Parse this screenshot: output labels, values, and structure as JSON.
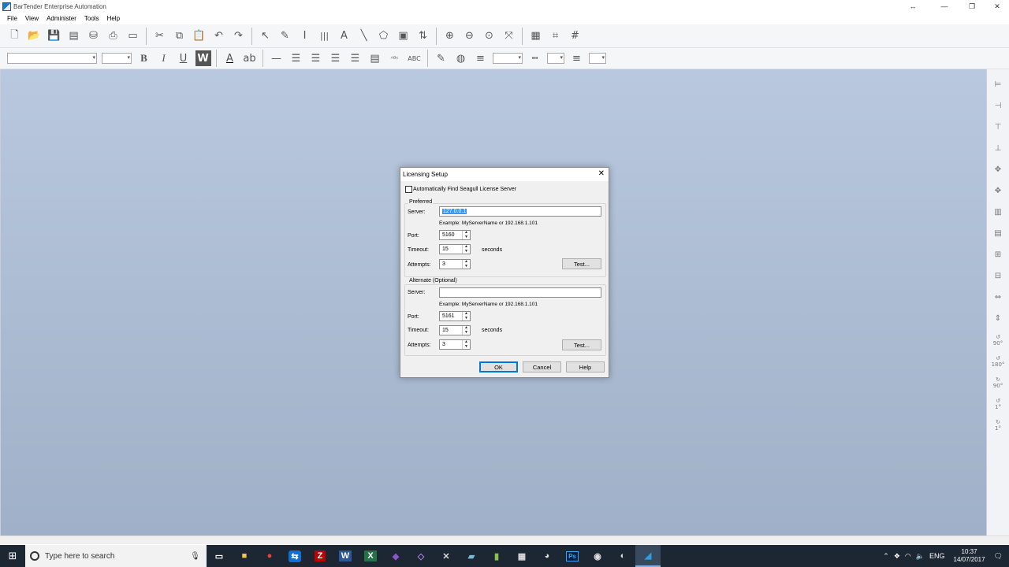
{
  "window": {
    "title": "BarTender Enterprise Automation",
    "restore_glyph": "↔"
  },
  "menu": [
    "File",
    "View",
    "Administer",
    "Tools",
    "Help"
  ],
  "toolbar1_icons": [
    "new-icon",
    "open-icon",
    "save-icon",
    "print-preview-icon",
    "database-icon",
    "print-icon",
    "page-setup-icon",
    "cut-icon",
    "copy-icon",
    "paste-icon",
    "undo-icon",
    "redo-icon",
    "select-icon",
    "brush-icon",
    "text-cursor-icon",
    "barcode-icon",
    "text-icon",
    "line-icon",
    "shape-icon",
    "picture-icon",
    "align-icon",
    "zoom-in-icon",
    "zoom-out-icon",
    "zoom-fit-icon",
    "zoom-page-icon",
    "ruler-icon",
    "snap-icon",
    "grid-icon"
  ],
  "toolbar2": {
    "bold": "B",
    "italic": "I",
    "underline": "U",
    "word_wrap": "W",
    "font_color": "A"
  },
  "dialog": {
    "title": "Licensing Setup",
    "auto_find_label": "Automatically Find Seagull License Server",
    "preferred": {
      "group_label": "Preferred",
      "server_label": "Server:",
      "server_value": "127.0.0.1",
      "example": "Example: MyServerName or 192.168.1.101",
      "port_label": "Port:",
      "port_value": "5160",
      "timeout_label": "Timeout:",
      "timeout_value": "15",
      "seconds": "seconds",
      "attempts_label": "Attempts:",
      "attempts_value": "3",
      "test_label": "Test..."
    },
    "alternate": {
      "group_label": "Alternate (Optional)",
      "server_label": "Server:",
      "server_value": "",
      "example": "Example: MyServerName or 192.168.1.101",
      "port_label": "Port:",
      "port_value": "5161",
      "timeout_label": "Timeout:",
      "timeout_value": "15",
      "seconds": "seconds",
      "attempts_label": "Attempts:",
      "attempts_value": "3",
      "test_label": "Test..."
    },
    "ok_label": "OK",
    "cancel_label": "Cancel",
    "help_label": "Help"
  },
  "right_toolbar": {
    "rotate_90": "90°",
    "rotate_180": "180°",
    "rotate_cw_90": "90°",
    "rotate_1": "1°",
    "rotate_cw_1": "1°"
  },
  "taskbar": {
    "search_placeholder": "Type here to search",
    "apps": [
      "task-view-icon",
      "file-explorer-icon",
      "chrome-icon",
      "teamviewer-icon",
      "filezilla-icon",
      "word-icon",
      "excel-icon",
      "visual-studio-icon",
      "visual-studio-preview-icon",
      "tools-icon",
      "notepad-icon",
      "notepadpp-icon",
      "calculator-icon",
      "paint-icon",
      "photoshop-icon",
      "obs-icon",
      "media-icon",
      "bartender-icon"
    ],
    "app_labels": {
      "filezilla": "Z",
      "word": "W",
      "excel": "X",
      "photoshop": "Ps"
    },
    "language": "ENG",
    "time": "10:37",
    "date": "14/07/2017"
  }
}
